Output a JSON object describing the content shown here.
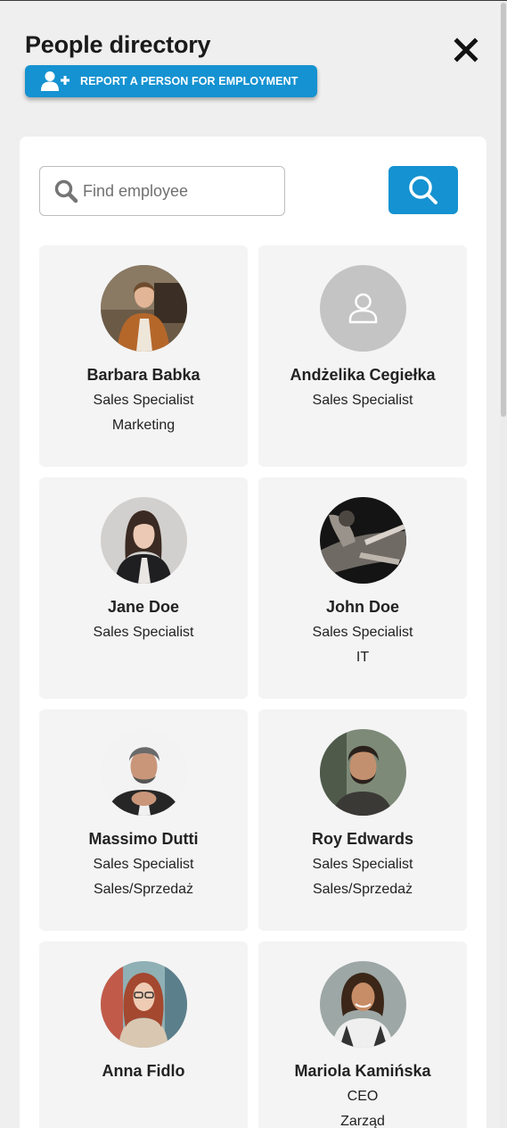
{
  "header": {
    "title": "People directory",
    "close_icon": "close-icon",
    "report_button": {
      "label": "REPORT A PERSON FOR EMPLOYMENT",
      "icon": "user-plus-icon"
    }
  },
  "search": {
    "placeholder": "Find employee",
    "value": "",
    "icon": "search-icon",
    "button_icon": "search-icon"
  },
  "colors": {
    "accent": "#1592d1",
    "background": "#efefef",
    "card": "#f4f4f4",
    "panel": "#ffffff"
  },
  "employees": [
    {
      "name": "Barbara Babka",
      "position": "Sales Specialist",
      "department": "Marketing",
      "avatar": "photo"
    },
    {
      "name": "Andżelika Cegiełka",
      "position": "Sales Specialist",
      "department": "",
      "avatar": "placeholder-user-icon"
    },
    {
      "name": "Jane Doe",
      "position": "Sales Specialist",
      "department": "",
      "avatar": "photo"
    },
    {
      "name": "John Doe",
      "position": "Sales Specialist",
      "department": "IT",
      "avatar": "photo"
    },
    {
      "name": "Massimo Dutti",
      "position": "Sales Specialist",
      "department": "Sales/Sprzedaż",
      "avatar": "photo"
    },
    {
      "name": "Roy Edwards",
      "position": "Sales Specialist",
      "department": "Sales/Sprzedaż",
      "avatar": "photo"
    },
    {
      "name": "Anna Fidlo",
      "position": "",
      "department": "",
      "avatar": "photo"
    },
    {
      "name": "Mariola Kamińska",
      "position": "CEO",
      "department": "Zarząd",
      "avatar": "photo"
    }
  ]
}
